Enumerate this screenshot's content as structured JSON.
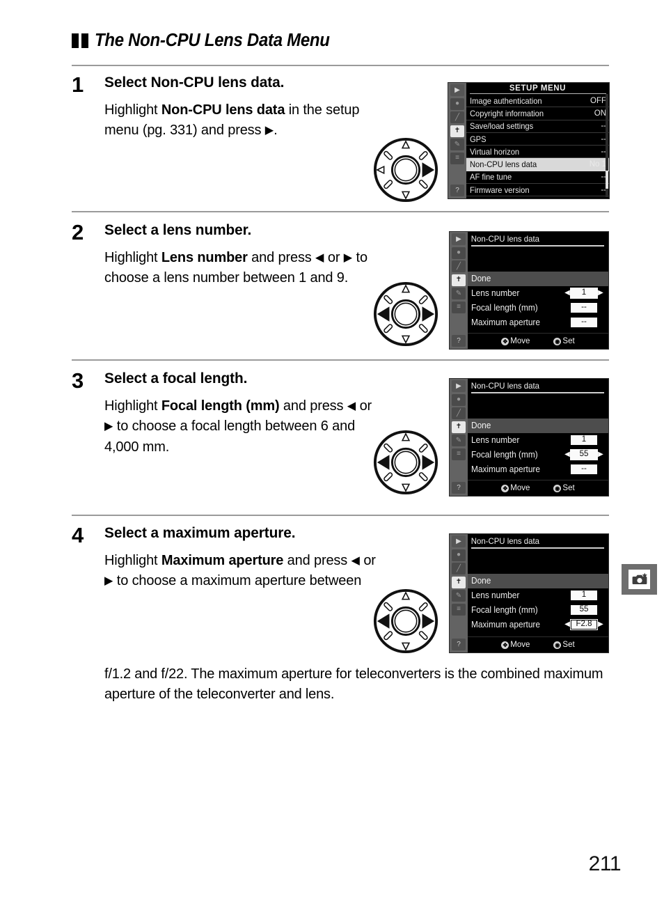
{
  "section": {
    "bullet_icon": "double-square-bullet",
    "title": "The Non-CPU Lens Data Menu"
  },
  "steps": [
    {
      "number": "1",
      "title_prefix": "Select ",
      "title_bold": "Non-CPU lens data",
      "title_suffix": ".",
      "para_1": "Highlight ",
      "para_bold": "Non-CPU lens data",
      "para_2": " in the setup menu (pg. 331) and press ",
      "para_arrow_right": "▶",
      "para_3": "."
    },
    {
      "number": "2",
      "title_prefix": "Select a lens number.",
      "title_bold": "",
      "title_suffix": "",
      "para_1": "Highlight ",
      "para_bold": "Lens number",
      "para_2": " and press ",
      "para_arrow_left": "◀",
      "para_mid": " or ",
      "para_arrow_right": "▶",
      "para_3": " to choose a lens number between 1 and 9."
    },
    {
      "number": "3",
      "title_prefix": "Select a focal length.",
      "title_bold": "",
      "title_suffix": "",
      "para_1": "Highlight ",
      "para_bold": "Focal length (mm)",
      "para_2": " and press ",
      "para_arrow_left": "◀",
      "para_mid": " or ",
      "para_arrow_right": "▶",
      "para_3": " to choose a focal length between 6 and 4,000 mm."
    },
    {
      "number": "4",
      "title_prefix": "Select a maximum aperture.",
      "title_bold": "",
      "title_suffix": "",
      "para_1": "Highlight ",
      "para_bold": "Maximum aperture",
      "para_2": " and press ",
      "para_arrow_left": "◀",
      "para_mid": " or ",
      "para_arrow_right": "▶",
      "para_3": " to choose a maximum aperture between",
      "para_tail": "f/1.2 and f/22.  The maximum aperture for teleconverters is the combined maximum aperture of the teleconverter and lens."
    }
  ],
  "dials": [
    {
      "name": "multi-selector-right",
      "active": [
        "right"
      ]
    },
    {
      "name": "multi-selector-left-right",
      "active": [
        "left",
        "right"
      ]
    },
    {
      "name": "multi-selector-left-right",
      "active": [
        "left",
        "right"
      ]
    },
    {
      "name": "multi-selector-left-right",
      "active": [
        "left",
        "right"
      ]
    }
  ],
  "setup_menu": {
    "title": "SETUP MENU",
    "sidebar_icons": [
      "playback-icon",
      "shooting-icon",
      "custom-settings-icon",
      "setup-wrench-icon",
      "retouch-icon",
      "recent-settings-icon",
      "help-icon"
    ],
    "rows": [
      {
        "label": "Image authentication",
        "value": "OFF",
        "highlighted": false
      },
      {
        "label": "Copyright information",
        "value": "ON",
        "highlighted": false
      },
      {
        "label": "Save/load settings",
        "value": "--",
        "highlighted": false
      },
      {
        "label": "GPS",
        "value": "--",
        "highlighted": false
      },
      {
        "label": "Virtual horizon",
        "value": "--",
        "highlighted": false
      },
      {
        "label": "Non-CPU lens data",
        "value": "No 1",
        "highlighted": true
      },
      {
        "label": "AF fine tune",
        "value": "--",
        "highlighted": false
      },
      {
        "label": "Firmware version",
        "value": "--",
        "highlighted": false
      }
    ]
  },
  "ncpu_screens": [
    {
      "title": "Non-CPU lens data",
      "done_label": "Done",
      "rows": [
        {
          "label": "Lens number",
          "value": "1",
          "selected": true
        },
        {
          "label": "Focal length (mm)",
          "value": "--",
          "selected": false
        },
        {
          "label": "Maximum aperture",
          "value": "--",
          "selected": false
        }
      ],
      "hint_move": "Move",
      "hint_set": "Set"
    },
    {
      "title": "Non-CPU lens data",
      "done_label": "Done",
      "rows": [
        {
          "label": "Lens number",
          "value": "1",
          "selected": false
        },
        {
          "label": "Focal length (mm)",
          "value": "55",
          "selected": true
        },
        {
          "label": "Maximum aperture",
          "value": "--",
          "selected": false
        }
      ],
      "hint_move": "Move",
      "hint_set": "Set"
    },
    {
      "title": "Non-CPU lens data",
      "done_label": "Done",
      "rows": [
        {
          "label": "Lens number",
          "value": "1",
          "selected": false
        },
        {
          "label": "Focal length (mm)",
          "value": "55",
          "selected": false
        },
        {
          "label": "Maximum aperture",
          "value": "F2.8",
          "selected": true
        }
      ],
      "hint_move": "Move",
      "hint_set": "Set"
    }
  ],
  "margin_tab": {
    "icon": "camera-star-icon"
  },
  "page_number": "211"
}
